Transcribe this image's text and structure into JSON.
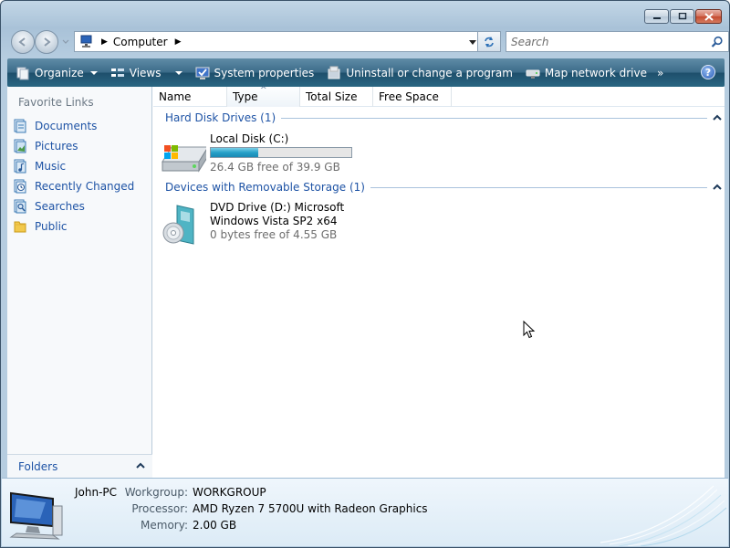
{
  "window": {
    "caption": {
      "minimize_icon": "minimize-icon",
      "maximize_icon": "maximize-icon",
      "close_icon": "close-icon"
    }
  },
  "address_bar": {
    "breadcrumb": [
      "Computer"
    ],
    "search_placeholder": "Search"
  },
  "toolbar": {
    "items": [
      {
        "label": "Organize",
        "icon": "organize-icon",
        "dropdown": true
      },
      {
        "label": "Views",
        "icon": "views-icon",
        "dropdown": true
      },
      {
        "label": "System properties",
        "icon": "system-properties-icon"
      },
      {
        "label": "Uninstall or change a program",
        "icon": "uninstall-icon"
      },
      {
        "label": "Map network drive",
        "icon": "map-drive-icon"
      }
    ],
    "overflow": "»",
    "help": "?"
  },
  "sidebar": {
    "title": "Favorite Links",
    "items": [
      {
        "label": "Documents",
        "icon": "documents-icon"
      },
      {
        "label": "Pictures",
        "icon": "pictures-icon"
      },
      {
        "label": "Music",
        "icon": "music-icon"
      },
      {
        "label": "Recently Changed",
        "icon": "recently-changed-icon"
      },
      {
        "label": "Searches",
        "icon": "searches-icon"
      },
      {
        "label": "Public",
        "icon": "public-icon"
      }
    ],
    "folders_label": "Folders"
  },
  "columns": [
    "Name",
    "Type",
    "Total Size",
    "Free Space"
  ],
  "groups": [
    {
      "title": "Hard Disk Drives (1)",
      "drives": [
        {
          "name": "Local Disk (C:)",
          "status": "26.4 GB free of 39.9 GB",
          "used_fraction": 0.338,
          "icon": "hard-disk-icon"
        }
      ]
    },
    {
      "title": "Devices with Removable Storage (1)",
      "drives": [
        {
          "name_line1": "DVD Drive (D:) Microsoft",
          "name_line2": "Windows Vista SP2 x64",
          "status": "0 bytes free of 4.55 GB",
          "icon": "dvd-drive-icon"
        }
      ]
    }
  ],
  "details": {
    "computer_name": "John-PC",
    "rows": [
      {
        "key": "Workgroup:",
        "value": "WORKGROUP"
      },
      {
        "key": "Processor:",
        "value": "AMD Ryzen 7 5700U with Radeon Graphics"
      },
      {
        "key": "Memory:",
        "value": "2.00 GB"
      }
    ]
  },
  "colors": {
    "link": "#1e53a5",
    "toolbar": "#2a6682",
    "bar_fill": "#26a0c8"
  }
}
